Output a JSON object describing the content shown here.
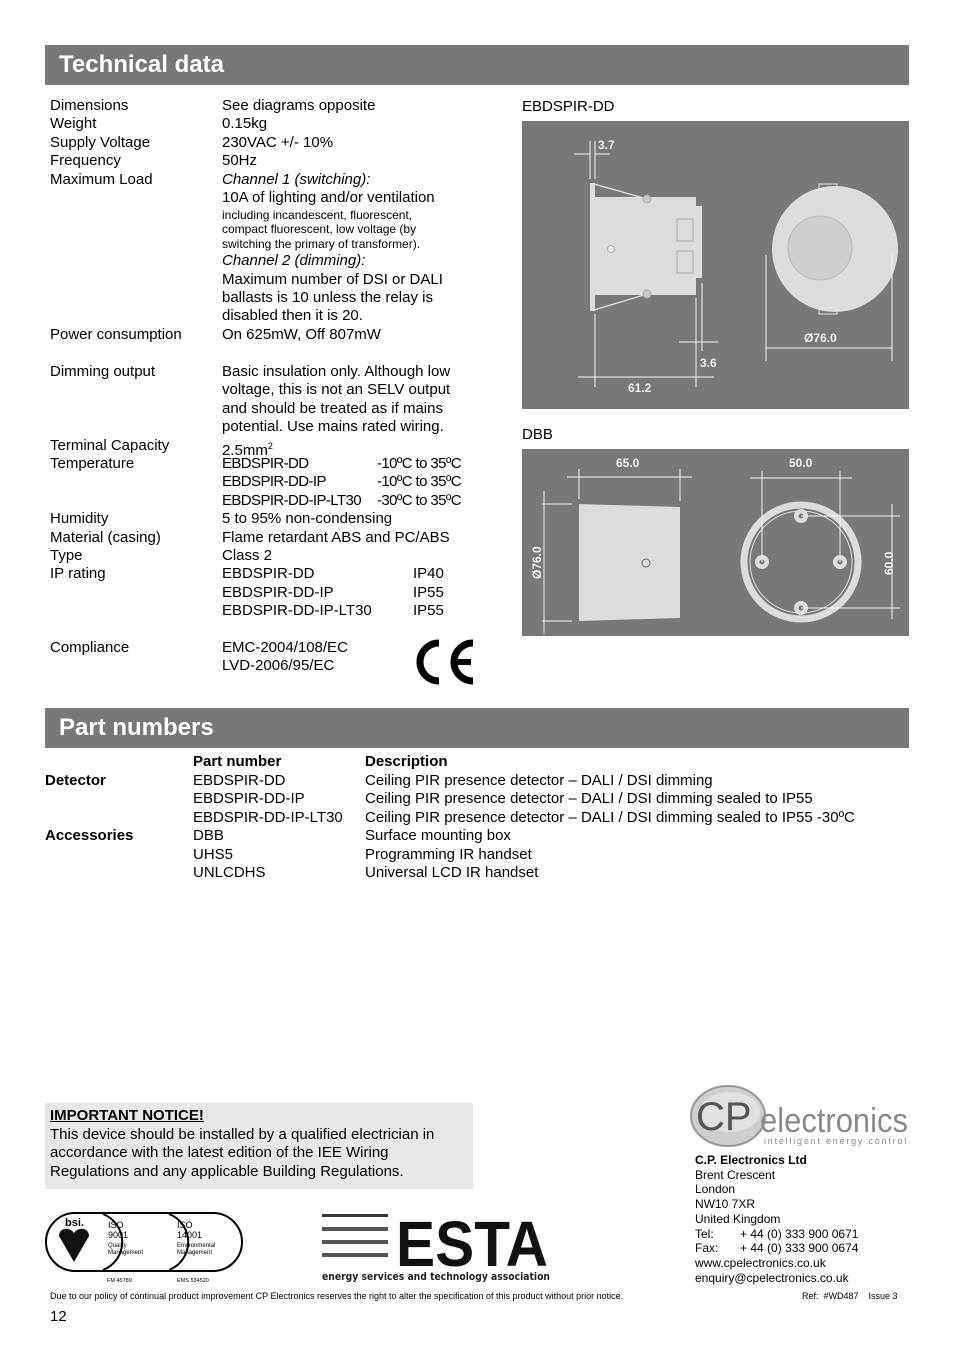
{
  "technical": {
    "title": "Technical data",
    "specs": {
      "dimensions": {
        "label": "Dimensions",
        "value": "See diagrams opposite"
      },
      "weight": {
        "label": "Weight",
        "value": "0.15kg"
      },
      "supply_voltage": {
        "label": "Supply Voltage",
        "value": "230VAC +/- 10%"
      },
      "frequency": {
        "label": "Frequency",
        "value": "50Hz"
      },
      "maximum_load": {
        "label": "Maximum Load",
        "ch1_title": "Channel 1 (switching):",
        "ch1_main": "10A of lighting and/or ventilation",
        "ch1_note": [
          "including incandescent, fluorescent,",
          "compact fluorescent, low voltage (by",
          "switching the primary of transformer)."
        ],
        "ch2_title": "Channel 2 (dimming):",
        "ch2_lines": [
          "Maximum number of DSI or DALI",
          "ballasts is 10 unless the relay is",
          "disabled then it is 20."
        ]
      },
      "power": {
        "label": "Power consumption",
        "value": "On 625mW, Off 807mW"
      },
      "dimming_output": {
        "label": "Dimming output",
        "lines": [
          "Basic insulation only. Although low",
          "voltage, this is not an SELV output",
          "and should be treated as if mains",
          "potential. Use mains rated wiring."
        ]
      },
      "terminal": {
        "label": "Terminal Capacity",
        "value": "2.5mm",
        "sup": "2"
      },
      "temperature": {
        "label": "Temperature",
        "rows": [
          {
            "model": "EBDSPIR-DD",
            "range": "-10ºC to 35ºC"
          },
          {
            "model": "EBDSPIR-DD-IP",
            "range": "-10ºC to 35ºC"
          },
          {
            "model": "EBDSPIR-DD-IP-LT30",
            "range": "-30ºC to 35ºC"
          }
        ]
      },
      "humidity": {
        "label": "Humidity",
        "value": "5 to 95% non-condensing"
      },
      "material": {
        "label": "Material (casing)",
        "value": "Flame retardant ABS and PC/ABS"
      },
      "type": {
        "label": "Type",
        "value": "Class 2"
      },
      "ip_rating": {
        "label": "IP rating",
        "rows": [
          {
            "model": "EBDSPIR-DD",
            "rating": "IP40"
          },
          {
            "model": "EBDSPIR-DD-IP",
            "rating": "IP55"
          },
          {
            "model": "EBDSPIR-DD-IP-LT30",
            "rating": "IP55"
          }
        ]
      },
      "compliance": {
        "label": "Compliance",
        "lines": [
          "EMC-2004/108/EC",
          "LVD-2006/95/EC"
        ],
        "mark": "CE"
      }
    }
  },
  "diagrams": {
    "ebdspir": {
      "label": "EBDSPIR-DD",
      "dims": {
        "flange": "3.7",
        "depth": "61.2",
        "lip": "3.6",
        "diameter": "Ø76.0"
      }
    },
    "dbb": {
      "label": "DBB",
      "dims": {
        "depth": "65.0",
        "diameter": "Ø76.0",
        "hole_h": "50.0",
        "hole_v": "60.0"
      }
    }
  },
  "parts": {
    "title": "Part numbers",
    "headers": {
      "part": "Part number",
      "desc": "Description"
    },
    "rows": [
      {
        "group": "Detector",
        "part": "EBDSPIR-DD",
        "desc": "Ceiling PIR presence detector – DALI / DSI dimming"
      },
      {
        "group": "",
        "part": "EBDSPIR-DD-IP",
        "desc": "Ceiling PIR presence detector – DALI / DSI dimming sealed to IP55"
      },
      {
        "group": "",
        "part": "EBDSPIR-DD-IP-LT30",
        "desc": "Ceiling PIR presence detector – DALI / DSI dimming sealed to IP55 -30ºC"
      },
      {
        "group": "Accessories",
        "part": "DBB",
        "desc": "Surface mounting box"
      },
      {
        "group": "",
        "part": "UHS5",
        "desc": "Programming IR handset"
      },
      {
        "group": "",
        "part": "UNLCDHS",
        "desc": "Universal LCD IR handset"
      }
    ]
  },
  "notice": {
    "title": "IMPORTANT NOTICE!",
    "lines": [
      "This device should be installed by a qualified electrician in",
      "accordance with the latest edition of the IEE Wiring",
      "Regulations and any applicable Building Regulations."
    ]
  },
  "logos": {
    "bsi": {
      "brand": "bsi.",
      "iso1": [
        "ISO",
        "9001",
        "Quality",
        "Management"
      ],
      "iso2": [
        "ISO",
        "14001",
        "Environmental",
        "Management"
      ],
      "cert1": "FM 45789",
      "cert2": "EMS 534520"
    },
    "esta": {
      "brand": "ESTA",
      "tagline": "energy services and technology association"
    },
    "cp": {
      "cp": "CP",
      "electronics": "electronics",
      "tagline": "intelligent energy control"
    }
  },
  "address": {
    "company": "C.P. Electronics Ltd",
    "lines": [
      "Brent Crescent",
      "London",
      "NW10 7XR",
      "United Kingdom"
    ],
    "tel_label": "Tel:",
    "tel": "+ 44 (0) 333 900 0671",
    "fax_label": "Fax:",
    "fax": "+ 44 (0) 333 900 0674",
    "web": "www.cpelectronics.co.uk",
    "email": "enquiry@cpelectronics.co.uk"
  },
  "footer": {
    "disclaimer": "Due to our policy of continual product improvement CP Electronics reserves the right to alter the specification of this product without prior notice.",
    "ref": "Ref:  #WD487    Issue 3",
    "page": "12"
  }
}
